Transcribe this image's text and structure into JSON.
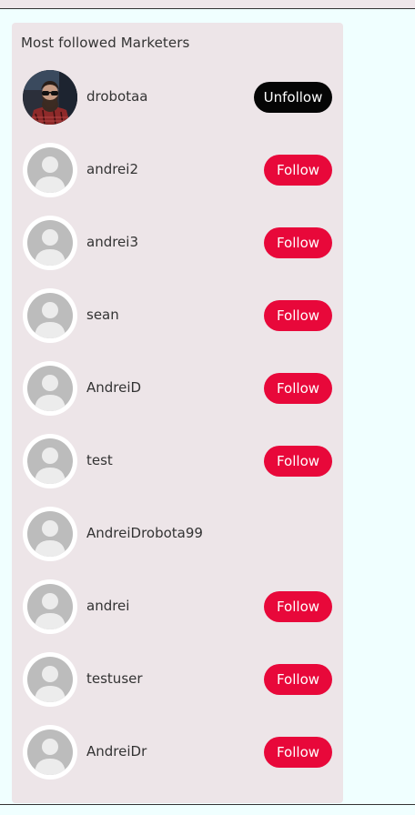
{
  "panel": {
    "title": "Most followed Marketers"
  },
  "colors": {
    "follow": "#e8083a",
    "unfollow": "#050505",
    "panel_bg": "#ede5e8",
    "page_bg": "#f0ffff"
  },
  "users": [
    {
      "name": "drobotaa",
      "avatar": "photo",
      "button": "Unfollow"
    },
    {
      "name": "andrei2",
      "avatar": "default",
      "button": "Follow"
    },
    {
      "name": "andrei3",
      "avatar": "default",
      "button": "Follow"
    },
    {
      "name": "sean",
      "avatar": "default",
      "button": "Follow"
    },
    {
      "name": "AndreiD",
      "avatar": "default",
      "button": "Follow"
    },
    {
      "name": "test",
      "avatar": "default",
      "button": "Follow"
    },
    {
      "name": "AndreiDrobota99",
      "avatar": "default",
      "button": ""
    },
    {
      "name": "andrei",
      "avatar": "default",
      "button": "Follow"
    },
    {
      "name": "testuser",
      "avatar": "default",
      "button": "Follow"
    },
    {
      "name": "AndreiDr",
      "avatar": "default",
      "button": "Follow"
    }
  ]
}
